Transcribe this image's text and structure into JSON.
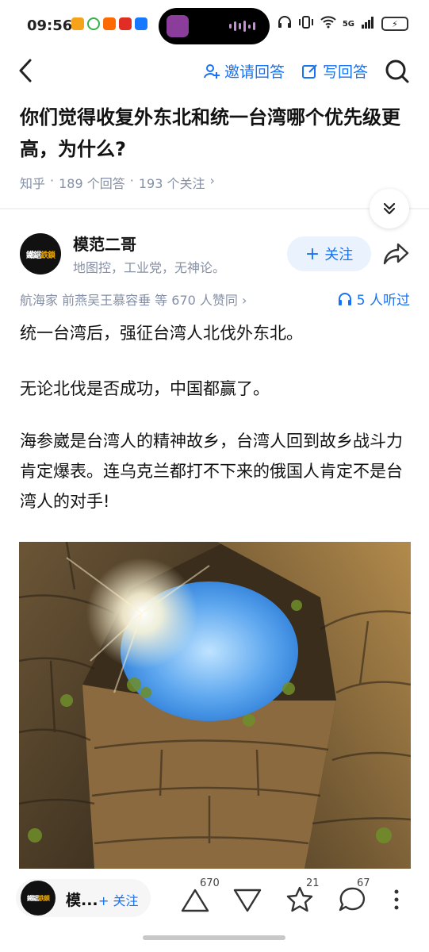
{
  "status_bar": {
    "time": "09:56",
    "network": "5G",
    "icons": [
      "heart-app-icon",
      "leaf-app-icon",
      "taobao-icon",
      "pinduoduo-icon",
      "alipay-icon",
      "headphone-icon",
      "vibrate-icon",
      "wifi-icon",
      "signal-icon",
      "battery-icon"
    ]
  },
  "nav": {
    "invite_label": "邀请回答",
    "write_label": "写回答"
  },
  "question": {
    "title": "你们觉得收复外东北和统一台湾哪个优先级更高，为什么?",
    "source": "知乎",
    "answers": "189 个回答",
    "followers": "193 个关注",
    "chevron": "›"
  },
  "author": {
    "name": "模范二哥",
    "bio": "地图控，工业党，无神论。",
    "avatar_text": "鐵鋸",
    "avatar_text_highlight": "鉄鎖",
    "follow_label": "关注"
  },
  "likers": {
    "text": "航海家 前燕吴王慕容垂 等 670 人赞同",
    "chevron": "›"
  },
  "listen": {
    "label": "5 人听过"
  },
  "answer": {
    "paragraphs": [
      "统一台湾后，强征台湾人北伐外东北。",
      "无论北伐是否成功，中国都赢了。",
      "海参崴是台湾人的精神故乡，台湾人回到故乡战斗力肯定爆表。连乌克兰都打不下来的俄国人肯定不是台湾人的对手!"
    ]
  },
  "bottom_bar": {
    "name": "模...",
    "follow_label": "+ 关注",
    "upvotes": "670",
    "stars": "21",
    "comments": "67"
  },
  "colors": {
    "accent": "#1772f6",
    "meta_gray": "#8590a6",
    "follow_bg": "#eaf2fd"
  }
}
